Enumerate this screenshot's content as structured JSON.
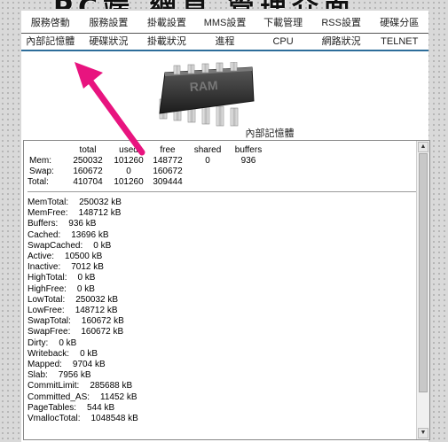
{
  "banner": {
    "text": "PC端 網頁 管理介面"
  },
  "menu": {
    "row1": [
      "服務啓動",
      "服務設置",
      "掛載設置",
      "MMS設置",
      "下載管理",
      "RSS設置",
      "硬碟分區"
    ],
    "row2": [
      "內部記憶體",
      "硬碟狀況",
      "掛載狀況",
      "進程",
      "CPU",
      "網路狀況",
      "TELNET"
    ]
  },
  "chip": {
    "label": "RAM",
    "caption": "內部記憶體"
  },
  "free": {
    "headers": [
      "",
      "total",
      "used",
      "free",
      "shared",
      "buffers"
    ],
    "rows": [
      [
        "Mem:",
        "250032",
        "101260",
        "148772",
        "0",
        "936"
      ],
      [
        "Swap:",
        "160672",
        "0",
        "160672",
        "",
        ""
      ],
      [
        "Total:",
        "410704",
        "101260",
        "309444",
        "",
        ""
      ]
    ]
  },
  "meminfo": [
    {
      "key": "MemTotal:",
      "value": "250032 kB"
    },
    {
      "key": "MemFree:",
      "value": "148712 kB"
    },
    {
      "key": "Buffers:",
      "value": "936 kB"
    },
    {
      "key": "Cached:",
      "value": "13696 kB"
    },
    {
      "key": "SwapCached:",
      "value": "0 kB"
    },
    {
      "key": "Active:",
      "value": "10500 kB"
    },
    {
      "key": "Inactive:",
      "value": "7012 kB"
    },
    {
      "key": "HighTotal:",
      "value": "0 kB"
    },
    {
      "key": "HighFree:",
      "value": "0 kB"
    },
    {
      "key": "LowTotal:",
      "value": "250032 kB"
    },
    {
      "key": "LowFree:",
      "value": "148712 kB"
    },
    {
      "key": "SwapTotal:",
      "value": "160672 kB"
    },
    {
      "key": "SwapFree:",
      "value": "160672 kB"
    },
    {
      "key": "Dirty:",
      "value": "0 kB"
    },
    {
      "key": "Writeback:",
      "value": "0 kB"
    },
    {
      "key": "Mapped:",
      "value": "9704 kB"
    },
    {
      "key": "Slab:",
      "value": "7956 kB"
    },
    {
      "key": "CommitLimit:",
      "value": "285688 kB"
    },
    {
      "key": "Committed_AS:",
      "value": "11452 kB"
    },
    {
      "key": "PageTables:",
      "value": "544 kB"
    },
    {
      "key": "VmallocTotal:",
      "value": "1048548 kB"
    }
  ],
  "colors": {
    "menu_rule": "#2d6d9a",
    "arrow": "#e8147f"
  }
}
